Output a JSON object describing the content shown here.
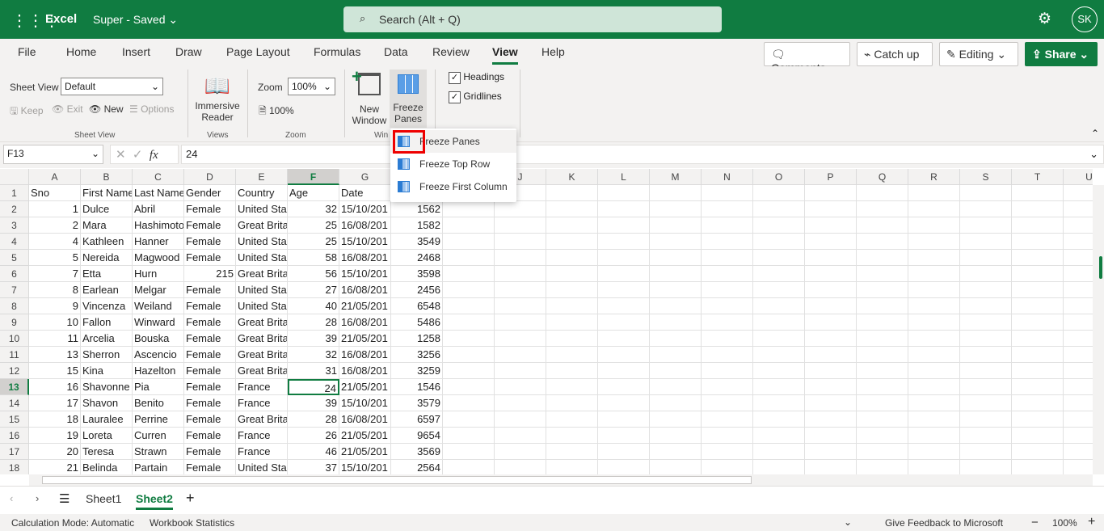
{
  "app": {
    "name": "Excel",
    "doc_title": "Super - Saved",
    "search_placeholder": "Search (Alt + Q)",
    "user_initials": "SK",
    "brand_color": "#107c41"
  },
  "tabs": [
    "File",
    "Home",
    "Insert",
    "Draw",
    "Page Layout",
    "Formulas",
    "Data",
    "Review",
    "View",
    "Help"
  ],
  "active_tab": "View",
  "actions": {
    "comments": "Comments",
    "catchup": "Catch up",
    "editing": "Editing",
    "share": "Share"
  },
  "ribbon": {
    "sheet_view_label": "Sheet View",
    "sheet_view_value": "Default",
    "keep": "Keep",
    "exit": "Exit",
    "new": "New",
    "options": "Options",
    "group_sheet_view": "Sheet View",
    "immersive1": "Immersive",
    "immersive2": "Reader",
    "group_views": "Views",
    "zoom_label": "Zoom",
    "zoom_value": "100%",
    "zoom100": "100%",
    "group_zoom": "Zoom",
    "new_window1": "New",
    "new_window2": "Window",
    "freeze1": "Freeze",
    "freeze2": "Panes",
    "group_window": "Win",
    "headings": "Headings",
    "gridlines": "Gridlines",
    "headings_checked": true,
    "gridlines_checked": true
  },
  "freeze_menu": [
    "Freeze Panes",
    "Freeze Top Row",
    "Freeze First Column"
  ],
  "formula": {
    "name_box": "F13",
    "fx": "fx",
    "value": "24"
  },
  "columns": [
    "A",
    "B",
    "C",
    "D",
    "E",
    "F",
    "G",
    "H",
    "I",
    "J",
    "K",
    "L",
    "M",
    "N",
    "O",
    "P",
    "Q",
    "R",
    "S",
    "T",
    "U"
  ],
  "selected_cell": {
    "col": "F",
    "row": 13
  },
  "rows": [
    [
      "Sno",
      "First Name",
      "Last Name",
      "Gender",
      "Country",
      "Age",
      "Date",
      ""
    ],
    [
      "1",
      "Dulce",
      "Abril",
      "Female",
      "United Sta",
      "32",
      "15/10/201",
      "1562"
    ],
    [
      "2",
      "Mara",
      "Hashimoto",
      "Female",
      "Great Brita",
      "25",
      "16/08/201",
      "1582"
    ],
    [
      "4",
      "Kathleen",
      "Hanner",
      "Female",
      "United Sta",
      "25",
      "15/10/201",
      "3549"
    ],
    [
      "5",
      "Nereida",
      "Magwood",
      "Female",
      "United Sta",
      "58",
      "16/08/201",
      "2468"
    ],
    [
      "7",
      "Etta",
      "Hurn",
      "215",
      "Great Brita",
      "56",
      "15/10/201",
      "3598"
    ],
    [
      "8",
      "Earlean",
      "Melgar",
      "Female",
      "United Sta",
      "27",
      "16/08/201",
      "2456"
    ],
    [
      "9",
      "Vincenza",
      "Weiland",
      "Female",
      "United Sta",
      "40",
      "21/05/201",
      "6548"
    ],
    [
      "10",
      "Fallon",
      "Winward",
      "Female",
      "Great Brita",
      "28",
      "16/08/201",
      "5486"
    ],
    [
      "11",
      "Arcelia",
      "Bouska",
      "Female",
      "Great Brita",
      "39",
      "21/05/201",
      "1258"
    ],
    [
      "13",
      "Sherron",
      "Ascencio",
      "Female",
      "Great Brita",
      "32",
      "16/08/201",
      "3256"
    ],
    [
      "15",
      "Kina",
      "Hazelton",
      "Female",
      "Great Brita",
      "31",
      "16/08/201",
      "3259"
    ],
    [
      "16",
      "Shavonne",
      "Pia",
      "Female",
      "France",
      "24",
      "21/05/201",
      "1546"
    ],
    [
      "17",
      "Shavon",
      "Benito",
      "Female",
      "France",
      "39",
      "15/10/201",
      "3579"
    ],
    [
      "18",
      "Lauralee",
      "Perrine",
      "Female",
      "Great Brita",
      "28",
      "16/08/201",
      "6597"
    ],
    [
      "19",
      "Loreta",
      "Curren",
      "Female",
      "France",
      "26",
      "21/05/201",
      "9654"
    ],
    [
      "20",
      "Teresa",
      "Strawn",
      "Female",
      "France",
      "46",
      "21/05/201",
      "3569"
    ],
    [
      "21",
      "Belinda",
      "Partain",
      "Female",
      "United Sta",
      "37",
      "15/10/201",
      "2564"
    ]
  ],
  "sheets": [
    "Sheet1",
    "Sheet2"
  ],
  "active_sheet": "Sheet2",
  "status": {
    "calc": "Calculation Mode: Automatic",
    "stats": "Workbook Statistics",
    "feedback": "Give Feedback to Microsoft",
    "minus": "−",
    "zoom": "100%",
    "plus": "+"
  }
}
